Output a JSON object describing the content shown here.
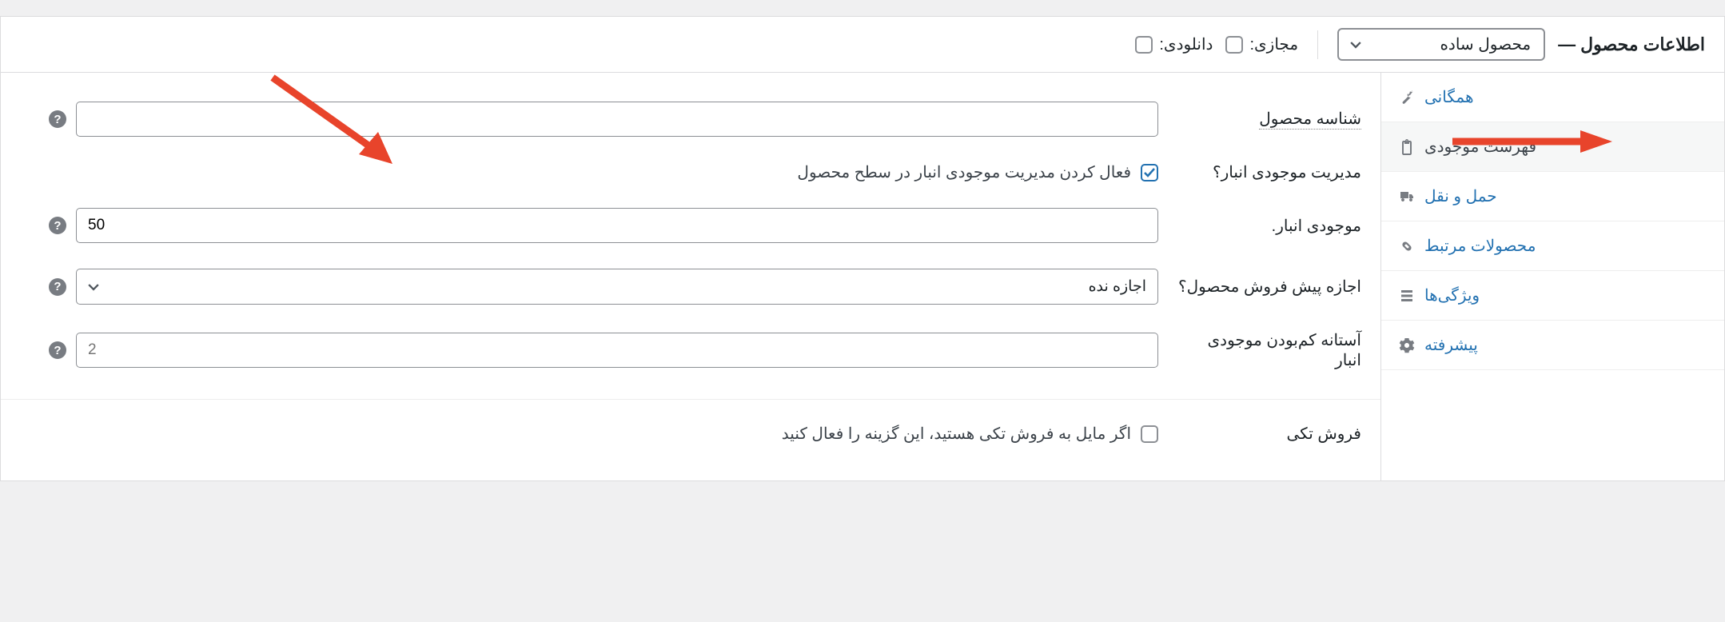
{
  "header": {
    "title": "اطلاعات محصول —",
    "product_type": "محصول ساده",
    "virtual_label": "مجازی:",
    "downloadable_label": "دانلودی:"
  },
  "tabs": {
    "general": "همگانی",
    "inventory": "فهرست موجودی",
    "shipping": "حمل و نقل",
    "linked": "محصولات مرتبط",
    "attributes": "ویژگی‌ها",
    "advanced": "پیشرفته"
  },
  "fields": {
    "sku_label": "شناسه محصول",
    "sku_value": "",
    "manage_stock_label": "مدیریت موجودی انبار؟",
    "manage_stock_desc": "فعال کردن مدیریت موجودی انبار در سطح محصول",
    "stock_qty_label": "موجودی انبار.",
    "stock_qty_value": "50",
    "backorders_label": "اجازه پیش فروش محصول؟",
    "backorders_value": "اجازه نده",
    "low_stock_label": "آستانه کم‌بودن موجودی انبار",
    "low_stock_placeholder": "2",
    "sold_ind_label": "فروش تکی",
    "sold_ind_desc": "اگر مایل به فروش تکی هستید، این گزینه را فعال کنید"
  }
}
